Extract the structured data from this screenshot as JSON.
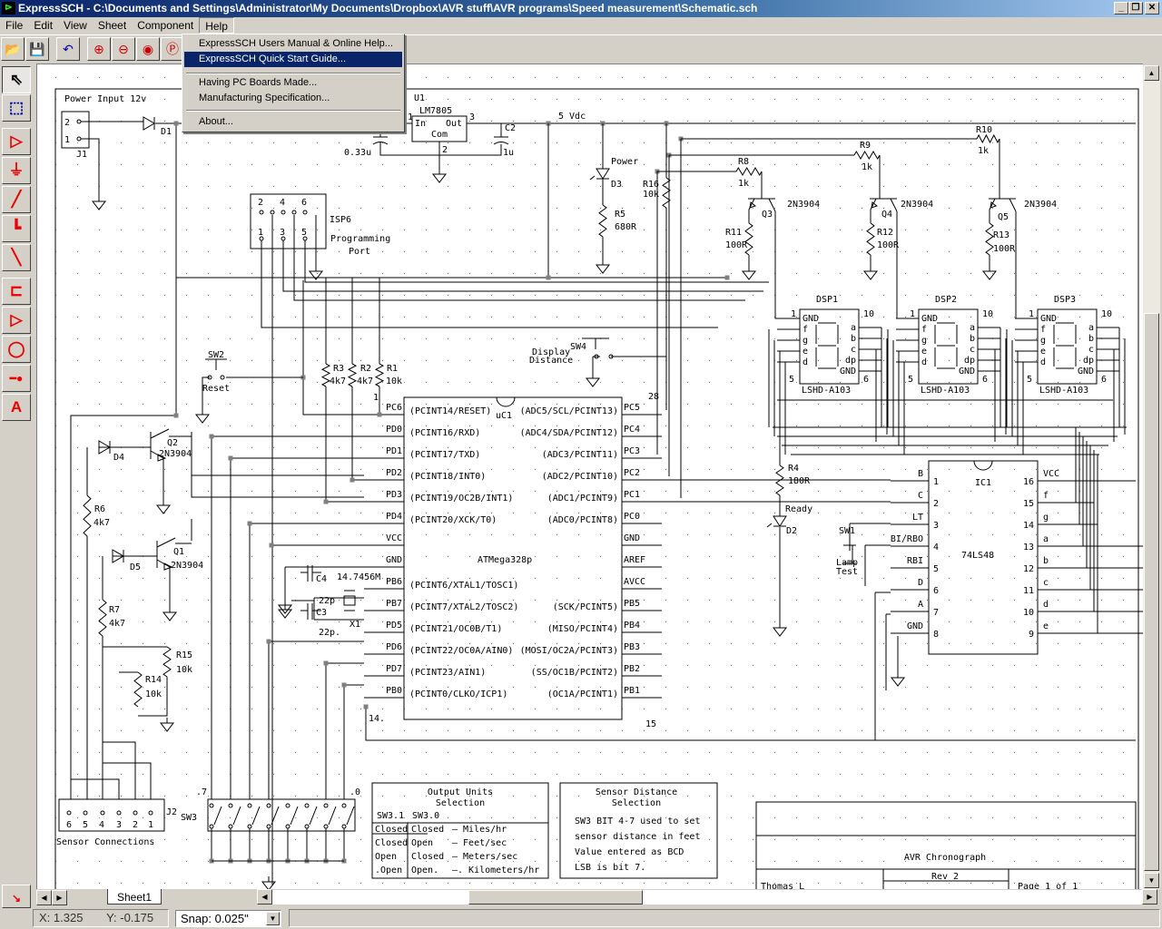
{
  "window": {
    "title": "ExpressSCH - C:\\Documents and Settings\\Administrator\\My Documents\\Dropbox\\AVR stuff\\AVR programs\\Speed measurement\\Schematic.sch",
    "minimize": "_",
    "restore": "❐",
    "close": "✕"
  },
  "menu": {
    "file": "File",
    "edit": "Edit",
    "view": "View",
    "sheet": "Sheet",
    "component": "Component",
    "help": "Help"
  },
  "help_menu": {
    "manual": "ExpressSCH Users Manual & Online Help...",
    "quick_start": "ExpressSCH Quick Start Guide...",
    "pcb": "Having PC Boards Made...",
    "manufacturing": "Manufacturing Specification...",
    "about": "About..."
  },
  "toolbar": {
    "open": "📂",
    "save": "💾",
    "undo": "↶",
    "zoom_in": "⊕",
    "zoom_out": "⊖",
    "zoom_fit": "◉",
    "zoom_page": "Ⓟ"
  },
  "palette": {
    "select": "⇖",
    "zoom_area": "⬚",
    "component": "▷",
    "ground": "⏚",
    "wire": "╱",
    "wire_corner": "┗",
    "line": "╲",
    "chip": "⊏",
    "buffer": "▷",
    "circle": "◯",
    "junction": "━●",
    "text": "A"
  },
  "sheet_tab": "Sheet1",
  "status": {
    "x": "X: 1.325",
    "y": "Y: -0.175",
    "snap": "Snap:  0.025\""
  },
  "colors": {
    "accent": "#0a246a",
    "tool_red": "#e00000",
    "junction": "#808080"
  },
  "schematic": {
    "labels": {
      "power_input": "Power Input 12v",
      "j1": "J1",
      "j1_p2": "2",
      "j1_p1": "1",
      "d1": "D1",
      "u1": "U1",
      "u1_part": "LM7805",
      "u1_in": "In",
      "u1_out": "Out",
      "u1_com": "Com",
      "u1_p1": "1",
      "u1_p3": "3",
      "u1_p2": "2",
      "c1_val": "0.33u",
      "c2": "C2",
      "c2_val": "1u",
      "vdc": "5 Vdc",
      "d3_note": "Power",
      "d3": "D3",
      "r5": "R5",
      "r5_val": "680R",
      "r16": "R16",
      "r16_val": "10k",
      "r8": "R8",
      "r8_val": "1k",
      "r9": "R9",
      "r9_val": "1k",
      "r10": "R10",
      "r10_val": "1k",
      "q3": "Q3",
      "q3_part": "2N3904",
      "q4": "Q4",
      "q4_part": "2N3904",
      "q5": "Q5",
      "q5_part": "2N3904",
      "r11": "R11",
      "r11_val": "100R",
      "r12": "R12",
      "r12_val": "100R",
      "r13": "R13",
      "r13_val": "100R",
      "isp": "ISP6",
      "isp_desc1": "Programming",
      "isp_desc2": "Port",
      "isp_p2": "2",
      "isp_p4": "4",
      "isp_p6": "6",
      "isp_p1": "1",
      "isp_p3": "3",
      "isp_p5": "5",
      "uc1": "uC1",
      "uc1_part": "ATMega328p",
      "uc1_p28": "28",
      "uc1_p1": "1",
      "uc1_p14": "14.",
      "uc1_p15": "15",
      "sw4": "SW4",
      "sw4_d1": "Display",
      "sw4_d2": "Distance",
      "r4": "R4",
      "r4_val": "180R",
      "d2": "D2",
      "d2_note": "Ready",
      "sw1": "SW1",
      "sw1_d1": "Lamp",
      "sw1_d2": "Test",
      "sw2": "SW2",
      "sw2_note": "Reset",
      "r3": "R3",
      "r3_val": "4k7",
      "r2": "R2",
      "r2_val": "4k7",
      "r1": "R1",
      "r1_val": "10k",
      "q2": "Q2",
      "q2_part": "2N3904",
      "d4": "D4",
      "r6": "R6",
      "r6_val": "4k7",
      "q1": "Q1",
      "q1_part": "2N3904",
      "d5": "D5",
      "r7": "R7",
      "r7_val": "4k7",
      "r15": "R15",
      "r15_val": "10k",
      "r14": "R14",
      "r14_val": "10k",
      "c4": "C4",
      "c4_val": "22p",
      "x1_val": "14.7456M",
      "c3": "C3",
      "c3_val": "22p.",
      "x1": "X1",
      "j2": "J2",
      "j2_p6": "6",
      "j2_p5": "5",
      "j2_p4": "4",
      "j2_p3": "3",
      "j2_p2": "2",
      "j2_p1": "1",
      "sensor_conn": "Sensor Connections",
      "sw3": "SW3",
      "sw3_b7": ".7",
      "sw3_b0": ".0",
      "ic1": "IC1",
      "ic1_part": "74LS48"
    },
    "uc1_left_pins": [
      {
        "pin": "PC6",
        "fn": "(PCINT14/RESET)"
      },
      {
        "pin": "PD0",
        "fn": "(PCINT16/RXD)"
      },
      {
        "pin": "PD1",
        "fn": "(PCINT17/TXD)"
      },
      {
        "pin": "PD2",
        "fn": "(PCINT18/INT0)"
      },
      {
        "pin": "PD3",
        "fn": "(PCINT19/OC2B/INT1)"
      },
      {
        "pin": "PD4",
        "fn": "(PCINT20/XCK/T0)"
      },
      {
        "pin": "VCC",
        "fn": ""
      },
      {
        "pin": "GND",
        "fn": ""
      },
      {
        "pin": "PB6",
        "fn": "(PCINT6/XTAL1/TOSC1)"
      },
      {
        "pin": "PB7",
        "fn": "(PCINT7/XTAL2/TOSC2)"
      },
      {
        "pin": "PD5",
        "fn": "(PCINT21/OC0B/T1)"
      },
      {
        "pin": "PD6",
        "fn": "(PCINT22/OC0A/AIN0)"
      },
      {
        "pin": "PD7",
        "fn": "(PCINT23/AIN1)"
      },
      {
        "pin": "PB0",
        "fn": "(PCINT0/CLKO/ICP1)"
      }
    ],
    "uc1_right_pins": [
      {
        "pin": "PC5",
        "fn": "(ADC5/SCL/PCINT13)"
      },
      {
        "pin": "PC4",
        "fn": "(ADC4/SDA/PCINT12)"
      },
      {
        "pin": "PC3",
        "fn": "(ADC3/PCINT11)"
      },
      {
        "pin": "PC2",
        "fn": "(ADC2/PCINT10)"
      },
      {
        "pin": "PC1",
        "fn": "(ADC1/PCINT9)"
      },
      {
        "pin": "PC0",
        "fn": "(ADC0/PCINT8)"
      },
      {
        "pin": "GND",
        "fn": ""
      },
      {
        "pin": "AREF",
        "fn": ""
      },
      {
        "pin": "AVCC",
        "fn": ""
      },
      {
        "pin": "PB5",
        "fn": "(SCK/PCINT5)"
      },
      {
        "pin": "PB4",
        "fn": "(MISO/PCINT4)"
      },
      {
        "pin": "PB3",
        "fn": "(MOSI/OC2A/PCINT3)"
      },
      {
        "pin": "PB2",
        "fn": "(SS/OC1B/PCINT2)"
      },
      {
        "pin": "PB1",
        "fn": "(OC1A/PCINT1)"
      }
    ],
    "ic1_left_pins": [
      {
        "name": "B",
        "num": "1"
      },
      {
        "name": "C",
        "num": "2"
      },
      {
        "name": "LT",
        "num": "3"
      },
      {
        "name": "BI/RBO",
        "num": "4"
      },
      {
        "name": "RBI",
        "num": "5"
      },
      {
        "name": "D",
        "num": "6"
      },
      {
        "name": "A",
        "num": "7"
      },
      {
        "name": "GND",
        "num": "8"
      }
    ],
    "ic1_right_pins": [
      {
        "name": "VCC",
        "num": "16"
      },
      {
        "name": "f",
        "num": "15"
      },
      {
        "name": "g",
        "num": "14"
      },
      {
        "name": "a",
        "num": "13"
      },
      {
        "name": "b",
        "num": "12"
      },
      {
        "name": "c",
        "num": "11"
      },
      {
        "name": "d",
        "num": "10"
      },
      {
        "name": "e",
        "num": "9"
      }
    ],
    "displays": [
      {
        "ref": "DSP1",
        "part": "LSHD-A103"
      },
      {
        "ref": "DSP2",
        "part": "LSHD-A103"
      },
      {
        "ref": "DSP3",
        "part": "LSHD-A103"
      }
    ],
    "display_pins": {
      "left": [
        "GND",
        "f",
        "g",
        "e",
        "d"
      ],
      "right": [
        "a",
        "b",
        "c",
        "dp",
        "GND"
      ],
      "nums": [
        "1",
        "10",
        "5",
        "6"
      ]
    },
    "output_units": {
      "title1": "Output Units",
      "title2": "Selection",
      "headers": [
        "SW3.1",
        "SW3.0"
      ],
      "rows": [
        [
          "Closed",
          "Closed",
          "—  Miles/hr"
        ],
        [
          "Closed",
          "Open",
          "—  Feet/sec"
        ],
        [
          "Open",
          "Closed",
          "—  Meters/sec"
        ],
        [
          ".Open",
          "Open.",
          "—. Kilometers/hr"
        ]
      ]
    },
    "sensor_distance": {
      "title1": "Sensor Distance",
      "title2": "Selection",
      "lines": [
        "SW3 BIT 4-7 used to set",
        "sensor distance in feet",
        "Value entered as BCD",
        "LSB is bit 7."
      ]
    },
    "title_block": {
      "title": "AVR Chronograph",
      "author": "Thomas L",
      "rev": "Rev 2",
      "page": "Page 1 of 1"
    }
  }
}
